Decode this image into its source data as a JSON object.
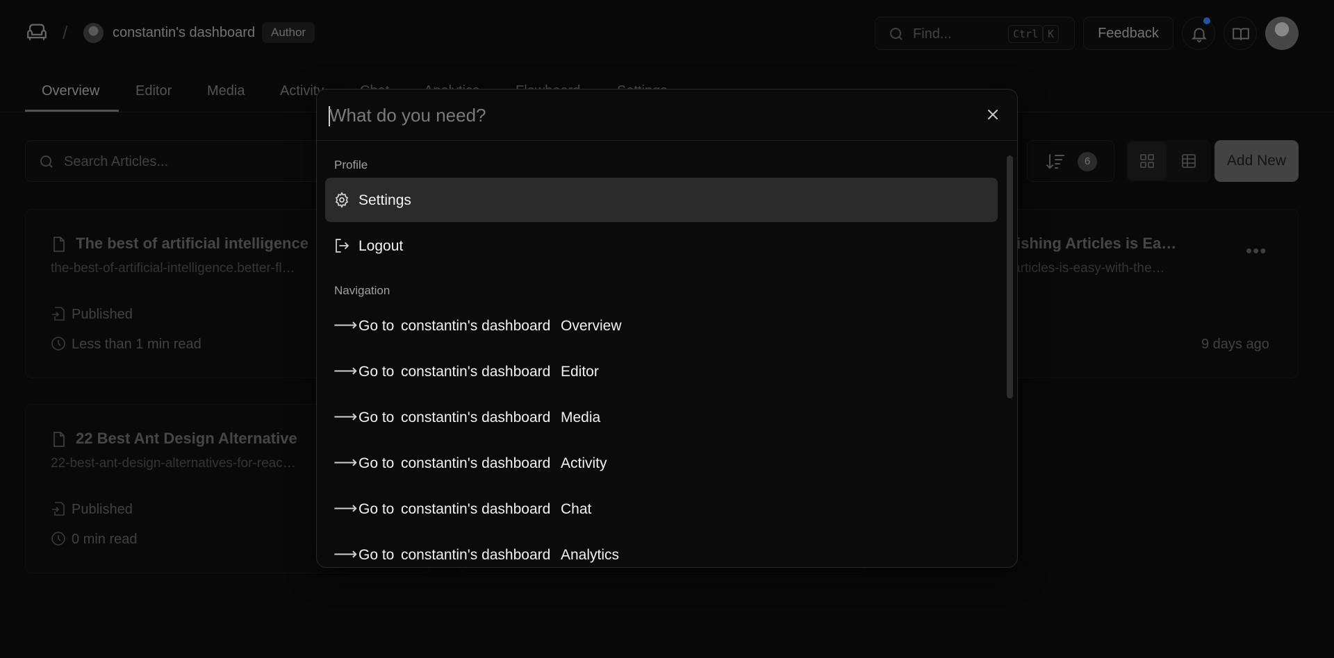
{
  "header": {
    "workspace_name": "constantin's dashboard",
    "role_badge": "Author",
    "find_placeholder": "Find...",
    "shortcut_keys": [
      "Ctrl",
      "K"
    ],
    "feedback_label": "Feedback"
  },
  "tabs": [
    {
      "label": "Overview",
      "active": true
    },
    {
      "label": "Editor"
    },
    {
      "label": "Media"
    },
    {
      "label": "Activity"
    },
    {
      "label": "Chat"
    },
    {
      "label": "Analytics"
    },
    {
      "label": "Flowboard"
    },
    {
      "label": "Settings"
    }
  ],
  "toolbar": {
    "search_placeholder": "Search Articles...",
    "sort_count": "6",
    "add_new_label": "Add New"
  },
  "cards": [
    {
      "title": "The best of artificial intelligence",
      "slug": "the-best-of-artificial-intelligence.better-fl…",
      "status": "Published",
      "read_time": "Less than 1 min read"
    },
    {
      "title": "…ishing Articles is Ea…",
      "slug": "…articles-is-easy-with-the…",
      "date": "9 days ago"
    },
    {
      "title": "22 Best Ant Design Alternative",
      "slug": "22-best-ant-design-alternatives-for-reac…",
      "status": "Published",
      "read_time": "0 min read"
    }
  ],
  "command_palette": {
    "placeholder": "What do you need?",
    "groups": {
      "profile": {
        "label": "Profile",
        "items": [
          {
            "label": "Settings",
            "icon": "gear-icon",
            "selected": true
          },
          {
            "label": "Logout",
            "icon": "logout-icon"
          }
        ]
      },
      "navigation": {
        "label": "Navigation",
        "prefix": "Go to",
        "workspace": "constantin's dashboard",
        "items": [
          "Overview",
          "Editor",
          "Media",
          "Activity",
          "Chat",
          "Analytics"
        ]
      }
    }
  },
  "colors": {
    "background": "#0b0b0b",
    "selected_item": "#2a2a2a",
    "notification_dot": "#2b6fd6",
    "add_new_button": "#5a5a5a"
  }
}
